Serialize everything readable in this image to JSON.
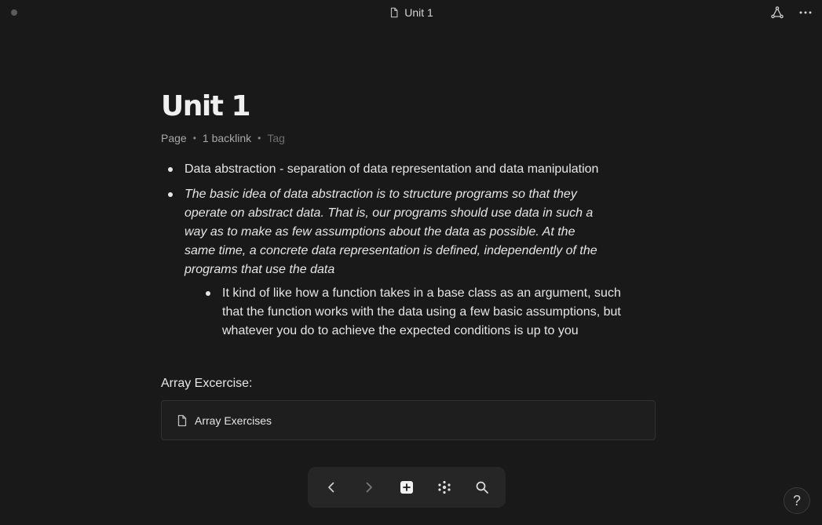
{
  "window": {
    "tab_title": "Unit 1"
  },
  "page": {
    "title": "Unit 1",
    "meta": {
      "type": "Page",
      "backlinks": "1 backlink",
      "tag_placeholder": "Tag"
    },
    "bullets": [
      {
        "text": "Data abstraction - separation of data representation and data manipulation",
        "style": "normal"
      },
      {
        "text": "The basic idea of data abstraction is to structure programs so that they operate on abstract data. That is, our programs should use data in such a way as to make as few assumptions about the data as possible. At the same time, a concrete data representation is defined, independently of the programs that use the data",
        "style": "italic"
      }
    ],
    "sub_bullets": [
      {
        "text": "It kind of like how a function takes in a base class as an argument, such that the function works with the data using a few basic assumptions, but whatever you do to achieve the expected conditions is up to you"
      }
    ],
    "section_label": "Array Excercise:",
    "linked_page": "Array Exercises"
  },
  "toolbar": {
    "icons": [
      "back-icon",
      "forward-icon",
      "new-page-icon",
      "graph-icon",
      "search-icon"
    ]
  },
  "help": {
    "label": "?"
  },
  "colors": {
    "background": "#191919",
    "text": "#e6e6e6",
    "muted": "#a8a8a8",
    "toolbar": "#262626"
  }
}
